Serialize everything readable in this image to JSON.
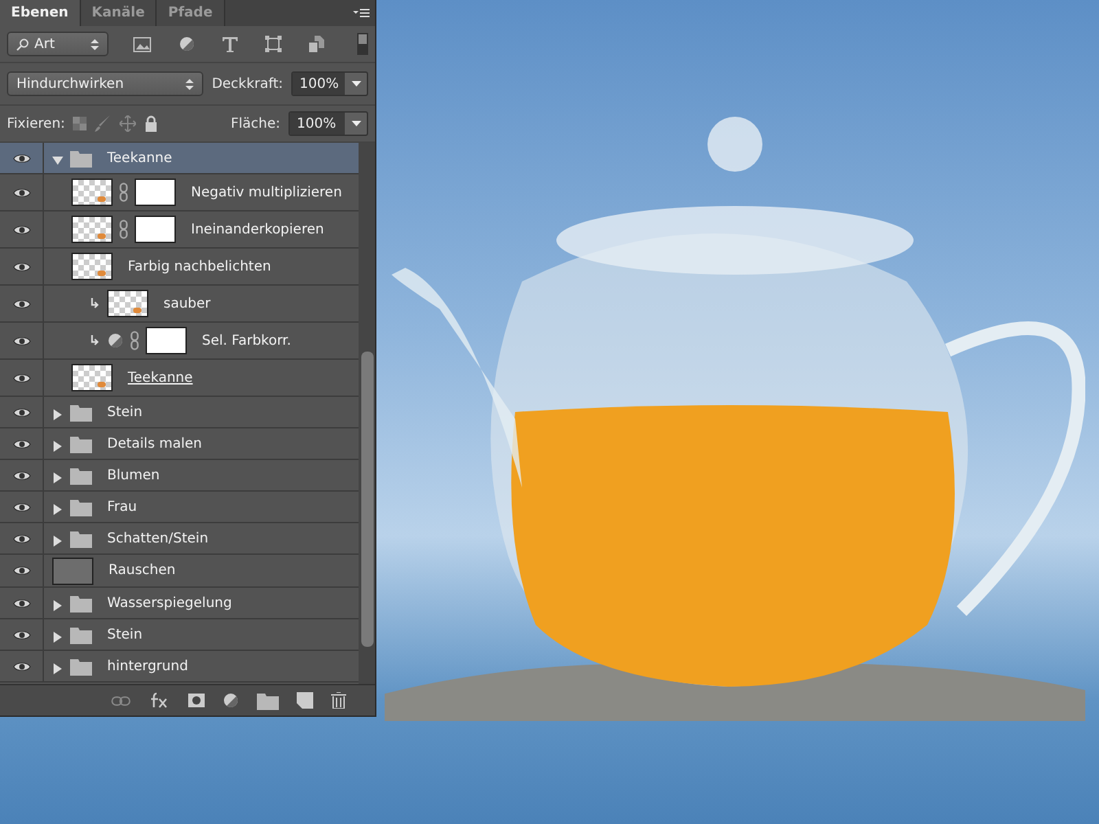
{
  "panel": {
    "tabs": [
      {
        "label": "Ebenen",
        "selected": true
      },
      {
        "label": "Kanäle",
        "selected": false
      },
      {
        "label": "Pfade",
        "selected": false
      }
    ],
    "filter": {
      "value": "Art"
    },
    "blend_mode": {
      "value": "Hindurchwirken"
    },
    "opacity": {
      "label": "Deckkraft:",
      "value": "100%"
    },
    "lock": {
      "label": "Fixieren:"
    },
    "fill": {
      "label": "Fläche:",
      "value": "100%"
    },
    "layers": [
      {
        "kind": "group",
        "name": "Teekanne",
        "expanded": true,
        "selected": true,
        "visible": true,
        "children": [
          {
            "kind": "pixel",
            "name": "Negativ multiplizieren",
            "mask": true,
            "clipped": false,
            "clipping_base": false,
            "selected": false,
            "visible": true
          },
          {
            "kind": "pixel",
            "name": "Ineinanderkopieren",
            "mask": true,
            "clipped": false,
            "clipping_base": false,
            "selected": false,
            "visible": true
          },
          {
            "kind": "pixel",
            "name": "Farbig nachbelichten",
            "mask": false,
            "clipped": false,
            "clipping_base": false,
            "selected": false,
            "visible": true
          },
          {
            "kind": "pixel",
            "name": "sauber",
            "mask": false,
            "clipped": true,
            "clipping_base": false,
            "selected": false,
            "visible": true
          },
          {
            "kind": "adjustment",
            "name": "Sel. Farbkorr.",
            "mask": true,
            "clipped": true,
            "clipping_base": false,
            "selected": false,
            "visible": true
          },
          {
            "kind": "pixel",
            "name": "Teekanne",
            "mask": false,
            "clipped": false,
            "clipping_base": true,
            "selected": false,
            "visible": true
          }
        ]
      },
      {
        "kind": "group",
        "name": "Stein",
        "expanded": false,
        "selected": false,
        "visible": true
      },
      {
        "kind": "group",
        "name": "Details malen",
        "expanded": false,
        "selected": false,
        "visible": true
      },
      {
        "kind": "group",
        "name": "Blumen",
        "expanded": false,
        "selected": false,
        "visible": true
      },
      {
        "kind": "group",
        "name": "Frau",
        "expanded": false,
        "selected": false,
        "visible": true
      },
      {
        "kind": "group",
        "name": "Schatten/Stein",
        "expanded": false,
        "selected": false,
        "visible": true
      },
      {
        "kind": "fill",
        "name": "Rauschen",
        "selected": false,
        "visible": true
      },
      {
        "kind": "group",
        "name": "Wasserspiegelung",
        "expanded": false,
        "selected": false,
        "visible": true
      },
      {
        "kind": "group",
        "name": "Stein",
        "expanded": false,
        "selected": false,
        "visible": true
      },
      {
        "kind": "group",
        "name": "hintergrund",
        "expanded": false,
        "selected": false,
        "visible": true
      }
    ]
  }
}
